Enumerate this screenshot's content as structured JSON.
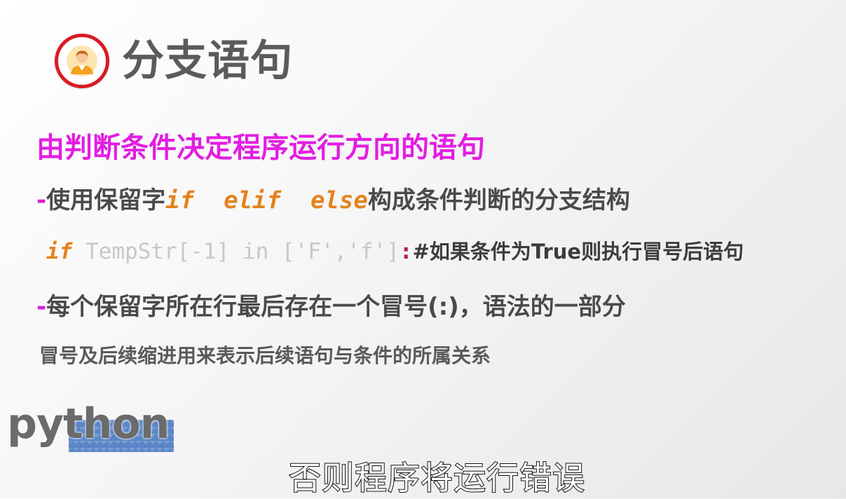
{
  "slide": {
    "title": "分支语句",
    "subtitle": "由判断条件决定程序运行方向的语句",
    "bullet1": {
      "dash": "-",
      "prefix": "使用保留字",
      "kw_if": "if",
      "kw_elif": "elif",
      "kw_else": "else",
      "suffix": "构成条件判断的分支结构"
    },
    "code": {
      "kw_if": "if",
      "expr": " TempStr[-1] in ['F','f']",
      "colon": ":",
      "comment": "#如果条件为True则执行冒号后语句"
    },
    "bullet2": {
      "dash": "-",
      "text": "每个保留字所在行最后存在一个冒号(:)，语法的一部分"
    },
    "note": "冒号及后续缩进用来表示后续语句与条件的所属关系"
  },
  "logo": {
    "text": "python",
    "icon": "python-logo"
  },
  "caption": "否则程序将运行错误",
  "colors": {
    "ring": "#d81b24",
    "subtitle": "#e21ee2",
    "keyword": "#e5821b",
    "title": "#5b5b5b",
    "logo_accent": "#5a86c8"
  }
}
